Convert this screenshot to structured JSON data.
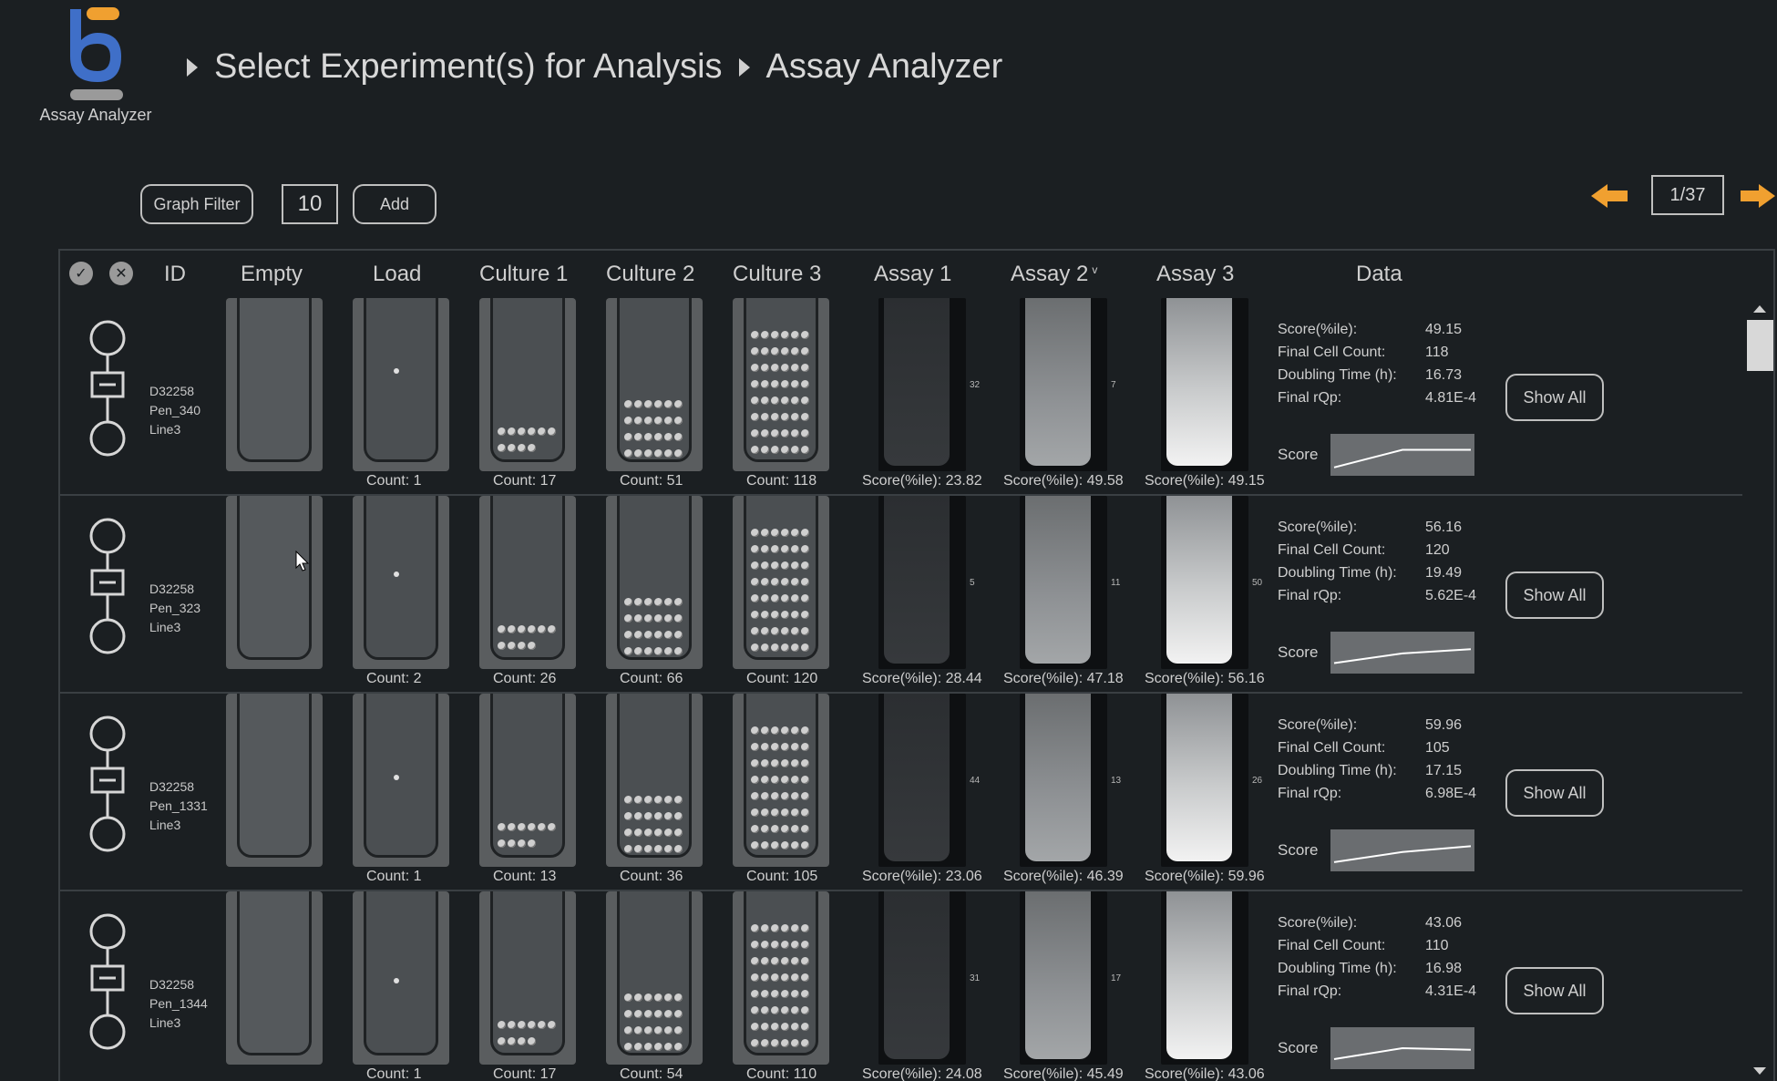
{
  "app": {
    "logo_label": "Assay Analyzer",
    "breadcrumbs": [
      "Select Experiment(s) for Analysis",
      "Assay Analyzer"
    ],
    "accent_orange": "#f0a030",
    "accent_blue": "#3f6fc8"
  },
  "toolbar": {
    "graph_filter_label": "Graph Filter",
    "count_value": "10",
    "add_label": "Add"
  },
  "pager": {
    "label": "1/37"
  },
  "table": {
    "headers": {
      "id": "ID",
      "empty": "Empty",
      "load": "Load",
      "culture1": "Culture 1",
      "culture2": "Culture 2",
      "culture3": "Culture 3",
      "assay1": "Assay 1",
      "assay2": "Assay 2",
      "assay3": "Assay 3",
      "data": "Data"
    },
    "sort_indicator": "v",
    "data_labels": {
      "score": "Score(%ile):",
      "final_cell_count": "Final Cell Count:",
      "doubling_time": "Doubling Time (h):",
      "final_rqp": "Final rQp:",
      "spark": "Score"
    },
    "show_all_label": "Show All",
    "rows": [
      {
        "id_line1": "D32258",
        "id_line2": "Pen_340",
        "id_line3": "Line3",
        "load_count": "Count: 1",
        "c1_count": "Count: 17",
        "c2_count": "Count: 51",
        "c3_count": "Count: 118",
        "a1_score": "Score(%ile): 23.82",
        "a2_score": "Score(%ile): 49.58",
        "a3_score": "Score(%ile): 49.15",
        "a1_num": "32",
        "a2_num": "7",
        "a3_num": "",
        "score": "49.15",
        "final_cell_count": "118",
        "doubling_time": "16.73",
        "final_rqp": "4.81E-4",
        "spark": [
          0.2,
          0.62,
          0.62
        ]
      },
      {
        "id_line1": "D32258",
        "id_line2": "Pen_323",
        "id_line3": "Line3",
        "load_count": "Count: 2",
        "c1_count": "Count: 26",
        "c2_count": "Count: 66",
        "c3_count": "Count: 120",
        "a1_score": "Score(%ile): 28.44",
        "a2_score": "Score(%ile): 47.18",
        "a3_score": "Score(%ile): 56.16",
        "a1_num": "5",
        "a2_num": "11",
        "a3_num": "50",
        "score": "56.16",
        "final_cell_count": "120",
        "doubling_time": "19.49",
        "final_rqp": "5.62E-4",
        "spark": [
          0.25,
          0.48,
          0.58
        ]
      },
      {
        "id_line1": "D32258",
        "id_line2": "Pen_1331",
        "id_line3": "Line3",
        "load_count": "Count: 1",
        "c1_count": "Count: 13",
        "c2_count": "Count: 36",
        "c3_count": "Count: 105",
        "a1_score": "Score(%ile): 23.06",
        "a2_score": "Score(%ile): 46.39",
        "a3_score": "Score(%ile): 59.96",
        "a1_num": "44",
        "a2_num": "13",
        "a3_num": "26",
        "score": "59.96",
        "final_cell_count": "105",
        "doubling_time": "17.15",
        "final_rqp": "6.98E-4",
        "spark": [
          0.22,
          0.46,
          0.6
        ]
      },
      {
        "id_line1": "D32258",
        "id_line2": "Pen_1344",
        "id_line3": "Line3",
        "load_count": "Count: 1",
        "c1_count": "Count: 17",
        "c2_count": "Count: 54",
        "c3_count": "Count: 110",
        "a1_score": "Score(%ile): 24.08",
        "a2_score": "Score(%ile): 45.49",
        "a3_score": "Score(%ile): 43.06",
        "a1_num": "31",
        "a2_num": "17",
        "a3_num": "",
        "score": "43.06",
        "final_cell_count": "110",
        "doubling_time": "16.98",
        "final_rqp": "4.31E-4",
        "spark": [
          0.24,
          0.5,
          0.46
        ]
      }
    ]
  }
}
